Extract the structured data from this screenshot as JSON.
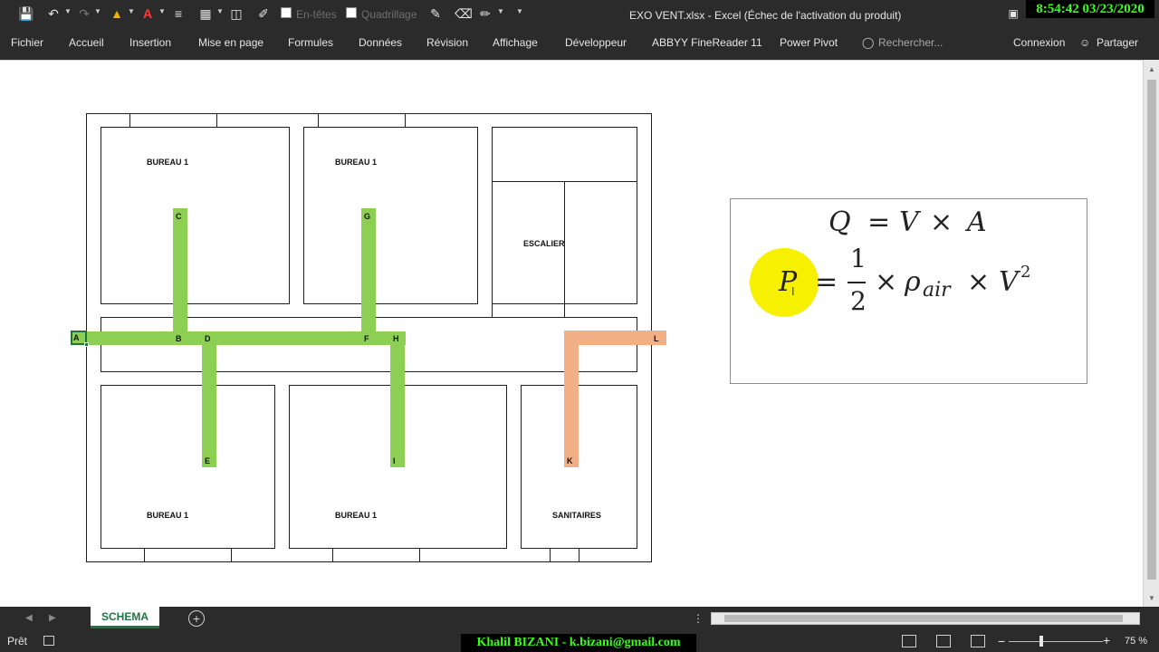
{
  "window": {
    "title": "EXO VENT.xlsx - Excel (Échec de l'activation du produit)",
    "clock": "8:54:42  03/23/2020"
  },
  "qat": {
    "headers_label": "En-têtes",
    "gridlines_label": "Quadrillage"
  },
  "ribbon": {
    "tabs": [
      "Fichier",
      "Accueil",
      "Insertion",
      "Mise en page",
      "Formules",
      "Données",
      "Révision",
      "Affichage",
      "Développeur",
      "ABBYY FineReader 11",
      "Power Pivot"
    ],
    "search_placeholder": "Rechercher...",
    "signin": "Connexion",
    "share": "Partager"
  },
  "plan": {
    "rooms": {
      "bureau_top_left": "BUREAU     1",
      "bureau_top_mid": "BUREAU     1",
      "escalier": "ESCALIER",
      "bureau_bot_left": "BUREAU     1",
      "bureau_bot_mid": "BUREAU     1",
      "sanitaires": "SANITAIRES"
    },
    "nodes": {
      "A": "A",
      "B": "B",
      "C": "C",
      "D": "D",
      "E": "E",
      "F": "F",
      "G": "G",
      "H": "H",
      "I": "I",
      "K": "K",
      "L": "L"
    }
  },
  "formula": {
    "q": "Q",
    "eq1": "=",
    "v1": "V",
    "times1": "×",
    "a": "A",
    "p": "P",
    "eq2": "=",
    "num": "1",
    "den": "2",
    "times2": "×",
    "rho": "ρ",
    "air": "air",
    "times3": "×",
    "v2": "V",
    "sq": "2"
  },
  "sheet_tabs": {
    "active": "SCHEMA",
    "add": "+"
  },
  "status": {
    "ready": "Prêt",
    "author": "Khalil BIZANI - k.bizani@gmail.com",
    "zoom": "75 %"
  },
  "colors": {
    "ribbon_bg": "#2b2b2b",
    "excel_green": "#217346",
    "duct_green": "#8dcf53",
    "duct_orange": "#f2ae85",
    "highlight_yellow": "#f7f000"
  }
}
